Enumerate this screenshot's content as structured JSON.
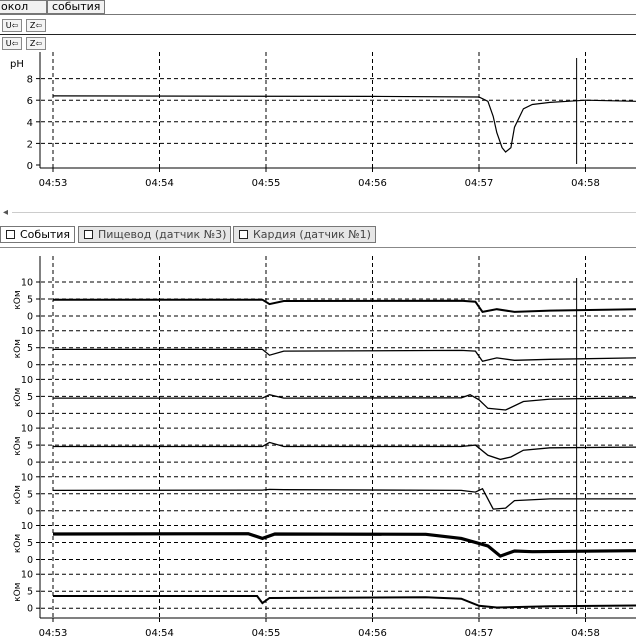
{
  "tabs": [
    {
      "label": "окол"
    },
    {
      "label": "события"
    }
  ],
  "toolbar": {
    "buttons": [
      {
        "label": "U⇦"
      },
      {
        "label": "Z⇦"
      },
      {
        "label": "U⇦"
      },
      {
        "label": "Z⇦"
      }
    ]
  },
  "scroll_arrow": "◂",
  "panel_tabs": [
    {
      "label": "События"
    },
    {
      "label": "Пищевод (датчик №3)"
    },
    {
      "label": "Кардия (датчик №1)"
    }
  ],
  "chart_data": [
    {
      "type": "line",
      "ylabel": "pH",
      "ylim": [
        0,
        9
      ],
      "yticks": [
        "0",
        "2",
        "4",
        "6",
        "8"
      ],
      "xticks": [
        "04:53",
        "04:54",
        "04:55",
        "04:56",
        "04:57",
        "04:58"
      ],
      "grid": true,
      "cursor_x": "04:57:55",
      "series": [
        {
          "x": [
            "04:53:00",
            "04:56:00",
            "04:57:00",
            "04:57:05",
            "04:57:08",
            "04:57:10",
            "04:57:13",
            "04:57:15",
            "04:57:18",
            "04:57:20",
            "04:57:25",
            "04:57:30",
            "04:57:40",
            "04:57:50",
            "04:58:00",
            "04:58:30"
          ],
          "values": [
            6.4,
            6.35,
            6.3,
            5.9,
            4.5,
            3.0,
            1.6,
            1.2,
            1.6,
            3.5,
            5.2,
            5.6,
            5.8,
            5.9,
            6.0,
            5.9
          ]
        }
      ]
    },
    {
      "type": "line",
      "ylabel": "кОм",
      "yticks": [
        "0",
        "5",
        "10"
      ],
      "xticks": [
        "04:53",
        "04:54",
        "04:55",
        "04:56",
        "04:57",
        "04:58"
      ],
      "grid": true,
      "cursor_x": "04:57:55",
      "channels": [
        {
          "x": [
            "04:53:00",
            "04:54:58",
            "04:55:02",
            "04:55:10",
            "04:56:50",
            "04:56:58",
            "04:57:02",
            "04:57:10",
            "04:57:20",
            "04:57:40",
            "04:58:30"
          ],
          "values": [
            4.8,
            4.8,
            3.5,
            4.4,
            4.5,
            4.2,
            1.2,
            2.0,
            1.2,
            1.6,
            2.0
          ]
        },
        {
          "x": [
            "04:53:00",
            "04:54:58",
            "04:55:02",
            "04:55:10",
            "04:56:50",
            "04:56:58",
            "04:57:02",
            "04:57:10",
            "04:57:20",
            "04:57:40",
            "04:58:30"
          ],
          "values": [
            4.5,
            4.5,
            2.8,
            4.0,
            4.2,
            4.0,
            1.0,
            2.0,
            1.3,
            1.6,
            2.0
          ]
        },
        {
          "x": [
            "04:53:00",
            "04:54:58",
            "04:55:02",
            "04:55:10",
            "04:56:50",
            "04:56:55",
            "04:57:00",
            "04:57:05",
            "04:57:15",
            "04:57:25",
            "04:57:40",
            "04:58:30"
          ],
          "values": [
            4.5,
            4.5,
            5.5,
            4.5,
            4.6,
            5.5,
            4.0,
            1.5,
            1.0,
            3.5,
            4.2,
            4.6
          ]
        },
        {
          "x": [
            "04:53:00",
            "04:54:58",
            "04:55:02",
            "04:55:10",
            "04:56:50",
            "04:56:58",
            "04:57:05",
            "04:57:12",
            "04:57:18",
            "04:57:25",
            "04:57:40",
            "04:58:30"
          ],
          "values": [
            4.6,
            4.6,
            5.8,
            4.6,
            4.6,
            5.0,
            2.0,
            0.8,
            1.5,
            3.5,
            4.2,
            4.4
          ]
        },
        {
          "x": [
            "04:53:00",
            "04:54:58",
            "04:55:02",
            "04:55:10",
            "04:56:50",
            "04:56:58",
            "04:57:02",
            "04:57:08",
            "04:57:15",
            "04:57:20",
            "04:57:40",
            "04:58:30"
          ],
          "values": [
            6.0,
            6.1,
            6.3,
            6.2,
            6.0,
            5.5,
            6.5,
            0.5,
            0.8,
            3.0,
            3.5,
            3.5
          ]
        },
        {
          "x": [
            "04:53:00",
            "04:54:50",
            "04:54:58",
            "04:55:05",
            "04:56:30",
            "04:56:50",
            "04:57:05",
            "04:57:12",
            "04:57:20",
            "04:57:30",
            "04:58:30"
          ],
          "values": [
            7.5,
            7.6,
            6.2,
            7.5,
            7.4,
            6.2,
            4.0,
            1.0,
            2.5,
            2.3,
            2.6
          ]
        },
        {
          "x": [
            "04:53:00",
            "04:54:55",
            "04:54:58",
            "04:55:02",
            "04:56:30",
            "04:56:50",
            "04:57:00",
            "04:57:10",
            "04:57:40",
            "04:58:30"
          ],
          "values": [
            3.6,
            3.6,
            1.5,
            3.0,
            3.2,
            2.8,
            0.7,
            0.2,
            0.6,
            0.8
          ]
        }
      ]
    }
  ]
}
